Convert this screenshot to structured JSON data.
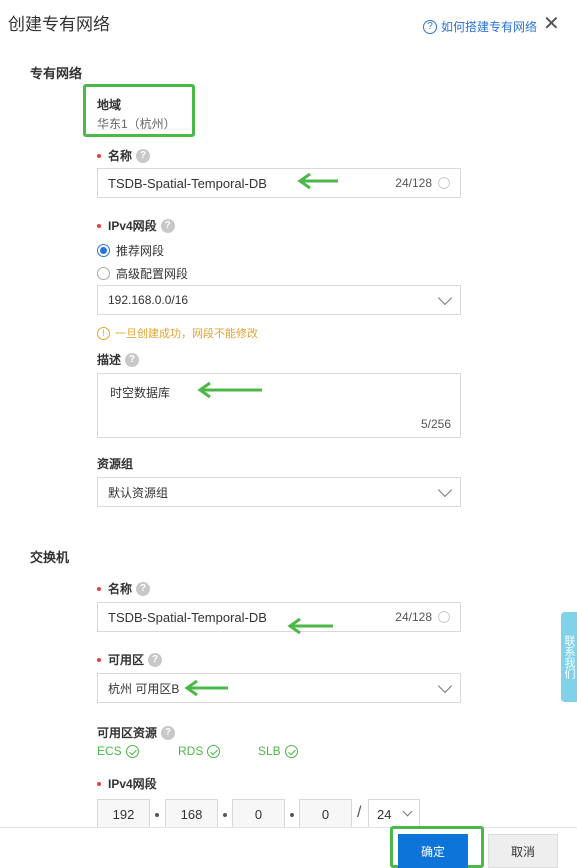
{
  "header": {
    "title": "创建专有网络",
    "help_icon": "question-circle-icon",
    "help_link": "如何搭建专有网络",
    "close_icon": "close-icon"
  },
  "vpc": {
    "section_title": "专有网络",
    "region_label": "地域",
    "region_value": "华东1（杭州）",
    "name_label": "名称",
    "name_value": "TSDB-Spatial-Temporal-DB",
    "name_count": "24/128",
    "cidr_label": "IPv4网段",
    "cidr_options": [
      "推荐网段",
      "高级配置网段"
    ],
    "cidr_selected": "推荐网段",
    "cidr_value": "192.168.0.0/16",
    "cidr_warning": "一旦创建成功，网段不能修改",
    "desc_label": "描述",
    "desc_value": "时空数据库",
    "desc_count": "5/256",
    "rg_label": "资源组",
    "rg_value": "默认资源组"
  },
  "vswitch": {
    "section_title": "交换机",
    "name_label": "名称",
    "name_value": "TSDB-Spatial-Temporal-DB",
    "name_count": "24/128",
    "zone_label": "可用区",
    "zone_value": "杭州 可用区B",
    "zone_resources_label": "可用区资源",
    "zone_resources": [
      "ECS",
      "RDS",
      "SLB"
    ],
    "cidr_label": "IPv4网段",
    "ip_octets": [
      "192",
      "168",
      "0",
      "0"
    ],
    "ip_slash": "/",
    "ip_mask": "24"
  },
  "side_tab": "联系我们",
  "footer": {
    "ok_label": "确定",
    "cancel_label": "取消"
  },
  "colors": {
    "accent": "#0d74d9",
    "annotation_green": "#4cb848",
    "warning": "#e0a535",
    "required": "#e0443b"
  }
}
